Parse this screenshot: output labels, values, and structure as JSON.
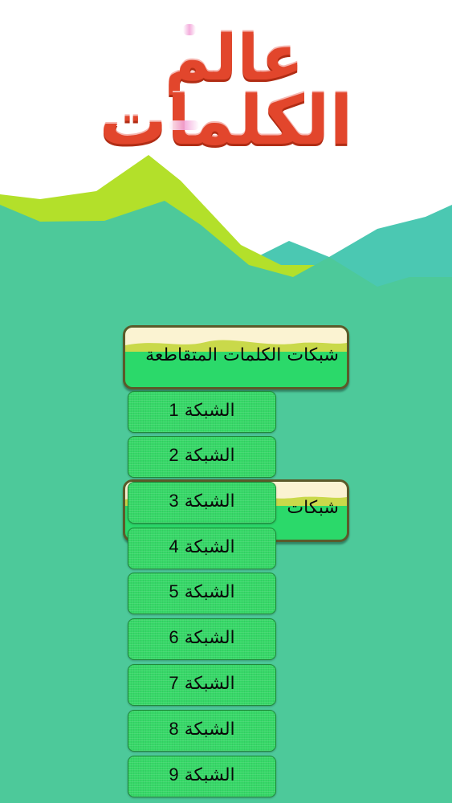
{
  "logo": {
    "line1": "عالم",
    "line2": "الكلمات"
  },
  "colors": {
    "sky": "#ffffff",
    "ground": "#4dc99a",
    "far_hill": "#4bc8b2",
    "lime_hill": "#b3e02a",
    "logo_red": "#e2462c",
    "button_green": "#36d867",
    "card_border": "#5b5a2a"
  },
  "categories": [
    {
      "label": "شبكات الكلمات المتقاطعة"
    },
    {
      "label": "شبكات"
    }
  ],
  "grids": [
    {
      "prefix": "الشبكة",
      "number": "1"
    },
    {
      "prefix": "الشبكة",
      "number": "2"
    },
    {
      "prefix": "الشبكة",
      "number": "3"
    },
    {
      "prefix": "الشبكة",
      "number": "4"
    },
    {
      "prefix": "الشبكة",
      "number": "5"
    },
    {
      "prefix": "الشبكة",
      "number": "6"
    },
    {
      "prefix": "الشبكة",
      "number": "7"
    },
    {
      "prefix": "الشبكة",
      "number": "8"
    },
    {
      "prefix": "الشبكة",
      "number": "9"
    }
  ]
}
